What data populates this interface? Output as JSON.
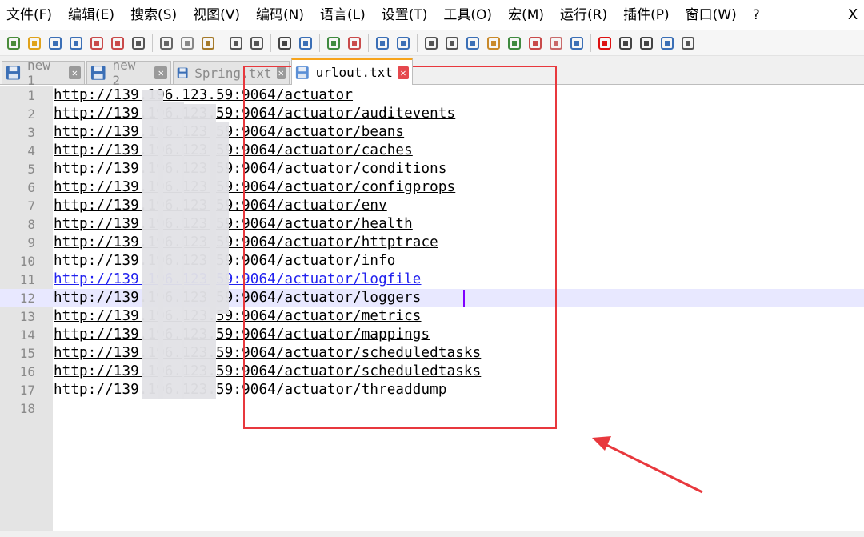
{
  "menu": {
    "items": [
      "文件(F)",
      "编辑(E)",
      "搜索(S)",
      "视图(V)",
      "编码(N)",
      "语言(L)",
      "设置(T)",
      "工具(O)",
      "宏(M)",
      "运行(R)",
      "插件(P)",
      "窗口(W)",
      "?"
    ],
    "close_label": "X"
  },
  "toolbar": {
    "icons": [
      "new-file-icon",
      "open-file-icon",
      "save-icon",
      "save-all-icon",
      "close-icon",
      "close-all-icon",
      "print-icon",
      "cut-icon",
      "copy-icon",
      "paste-icon",
      "undo-icon",
      "redo-icon",
      "find-icon",
      "replace-icon",
      "zoom-in-icon",
      "zoom-out-icon",
      "sync-vertical-icon",
      "sync-horizontal-icon",
      "word-wrap-icon",
      "show-all-chars-icon",
      "indent-guide-icon",
      "lang-icon",
      "doc-map-icon",
      "function-list-icon",
      "folder-as-workspace-icon",
      "monitoring-icon",
      "record-macro-icon",
      "stop-macro-icon",
      "play-macro-icon",
      "run-macro-multiple-icon",
      "save-macro-icon"
    ]
  },
  "tabs": [
    {
      "label": "new 1",
      "active": false
    },
    {
      "label": "new 2",
      "active": false
    },
    {
      "label": "Spring.txt",
      "active": false
    },
    {
      "label": "urlout.txt",
      "active": true
    }
  ],
  "editor": {
    "current_line": 12,
    "selected_line": 11,
    "lines": [
      {
        "num": "1",
        "text": "http://139.196.123.59:9064/actuator"
      },
      {
        "num": "2",
        "text": "http://139.196.123.59:9064/actuator/auditevents"
      },
      {
        "num": "3",
        "text": "http://139.196.123.59:9064/actuator/beans"
      },
      {
        "num": "4",
        "text": "http://139.196.123.59:9064/actuator/caches"
      },
      {
        "num": "5",
        "text": "http://139.196.123.59:9064/actuator/conditions"
      },
      {
        "num": "6",
        "text": "http://139.196.123.59:9064/actuator/configprops"
      },
      {
        "num": "7",
        "text": "http://139.196.123.59:9064/actuator/env"
      },
      {
        "num": "8",
        "text": "http://139.196.123.59:9064/actuator/health"
      },
      {
        "num": "9",
        "text": "http://139.196.123.59:9064/actuator/httptrace"
      },
      {
        "num": "10",
        "text": "http://139.196.123.59:9064/actuator/info"
      },
      {
        "num": "11",
        "text": "http://139.196.123.59:9064/actuator/logfile"
      },
      {
        "num": "12",
        "text": "http://139.196.123.59:9064/actuator/loggers"
      },
      {
        "num": "13",
        "text": "http://139.196.123.59:9064/actuator/metrics"
      },
      {
        "num": "14",
        "text": "http://139.196.123.59:9064/actuator/mappings"
      },
      {
        "num": "15",
        "text": "http://139.196.123.59:9064/actuator/scheduledtasks"
      },
      {
        "num": "16",
        "text": "http://139.196.123.59:9064/actuator/scheduledtasks"
      },
      {
        "num": "17",
        "text": "http://139.196.123.59:9064/actuator/threaddump"
      },
      {
        "num": "18",
        "text": ""
      }
    ]
  },
  "colors": {
    "annotation": "#e8383d",
    "active_tab_accent": "#f7a41c",
    "current_line_bg": "#e8e8ff",
    "caret": "#8000ff"
  }
}
